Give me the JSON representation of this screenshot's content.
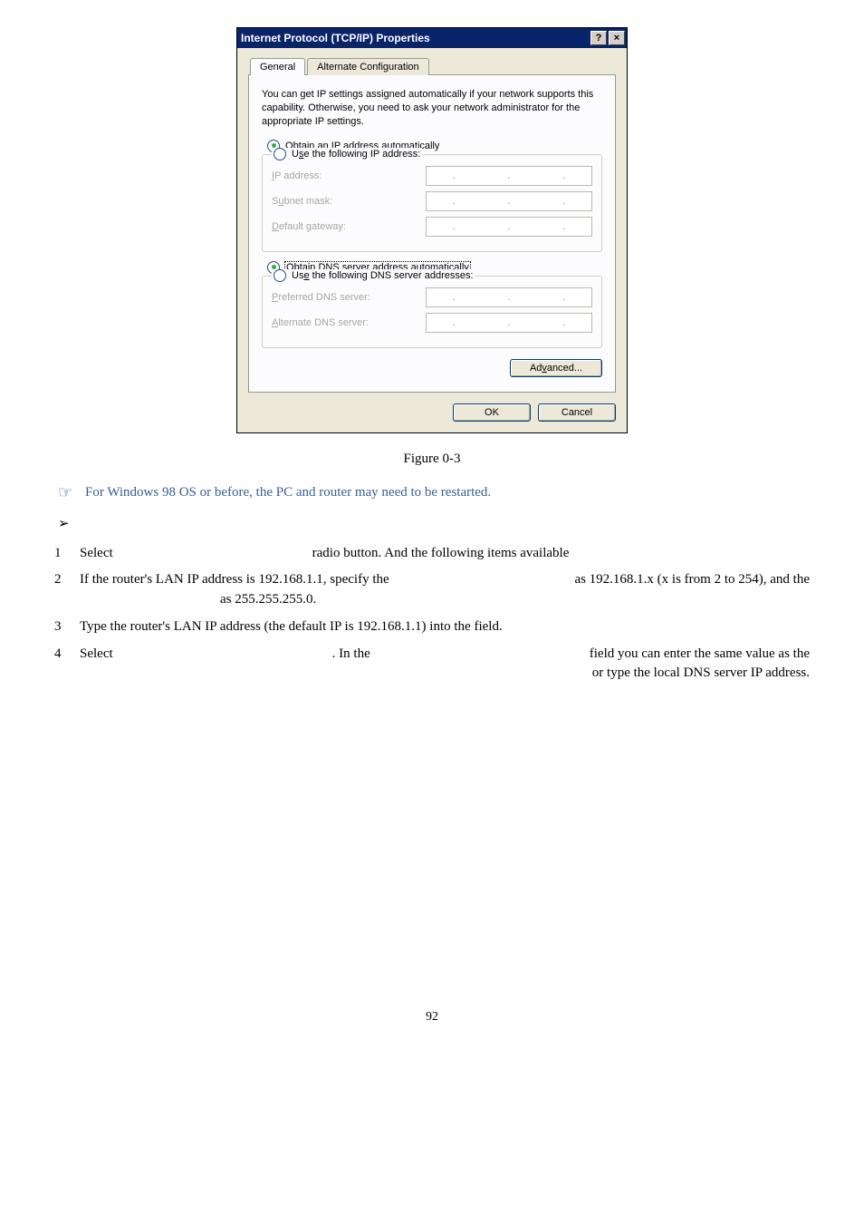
{
  "dialog": {
    "title": "Internet Protocol (TCP/IP) Properties",
    "help_glyph": "?",
    "close_glyph": "×",
    "tabs": {
      "general": "General",
      "alternate": "Alternate Configuration"
    },
    "description": "You can get IP settings assigned automatically if your network supports this capability. Otherwise, you need to ask your network administrator for the appropriate IP settings.",
    "ip_group": {
      "auto": {
        "pre": "O",
        "u": "b",
        "post": "tain an IP address automatically"
      },
      "manual": {
        "pre": "U",
        "u": "s",
        "post": "e the following IP address:"
      },
      "fields": {
        "ip": {
          "pre": "I",
          "u": "",
          "post": "P address:"
        },
        "subnet": {
          "pre": "S",
          "u": "u",
          "post": "bnet mask:"
        },
        "gateway": {
          "pre": "D",
          "u": "",
          "post": "efault gateway:"
        }
      }
    },
    "dns_group": {
      "auto": {
        "pre": "O",
        "u": "b",
        "post": "tain DNS server address automatically"
      },
      "manual": {
        "pre": "Us",
        "u": "e",
        "post": " the following DNS server addresses:"
      },
      "fields": {
        "preferred": {
          "pre": "P",
          "u": "",
          "post": "referred DNS server:"
        },
        "alternate": {
          "pre": "A",
          "u": "",
          "post": "lternate DNS server:"
        }
      }
    },
    "advanced": {
      "pre": "Ad",
      "u": "v",
      "post": "anced..."
    },
    "ok": "OK",
    "cancel": "Cancel"
  },
  "figure_caption": "Figure 0-3",
  "note_icon": "☞",
  "note_text": "For Windows 98 OS or before, the PC and router may need to be restarted.",
  "arrow": "➢",
  "steps": {
    "s1": {
      "n": "1",
      "a": "Select",
      "b": "radio button. And the following items available"
    },
    "s2": {
      "n": "2",
      "a": "If the router's LAN IP address is 192.168.1.1, specify the",
      "b": "as 192.168.1.x (x is from 2 to 254), and the",
      "c": "as 255.255.255.0."
    },
    "s3": {
      "n": "3",
      "a": "Type the router's LAN IP address (the default IP is 192.168.1.1) into the",
      "b": "field."
    },
    "s4": {
      "n": "4",
      "a": "Select",
      "b": ".  In the",
      "c": "field you can enter the same value as the",
      "d": "or type the local DNS server IP address."
    }
  },
  "page_number": "92"
}
